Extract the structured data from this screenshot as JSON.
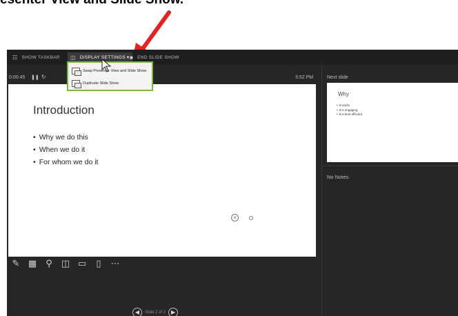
{
  "heading": "esenter View and Slide Show.",
  "topbar": {
    "show_taskbar": "SHOW TASKBAR",
    "display_settings": "DISPLAY SETTINGS ▾",
    "end_slide_show": "END SLIDE SHOW"
  },
  "menu": {
    "items": [
      {
        "label": "Swap Presenter View and Slide Show"
      },
      {
        "label": "Duplicate Slide Show"
      }
    ]
  },
  "presenter": {
    "timer": "0:00:45",
    "clock": "3:52 PM",
    "next_slide_label": "Next slide",
    "notes": "No Notes."
  },
  "slide": {
    "title": "Introduction",
    "bullets": [
      "Why we do this",
      "When we do it",
      "For whom we do it"
    ]
  },
  "next_slide": {
    "title": "Why",
    "bullets": [
      "It works",
      "It is engaging",
      "It is time efficient"
    ]
  },
  "nav": {
    "counter": "Slide 2 of 3"
  },
  "colors": {
    "accent_arrow": "#e32222",
    "menu_border": "#7ab648",
    "app_background": "#262626"
  }
}
